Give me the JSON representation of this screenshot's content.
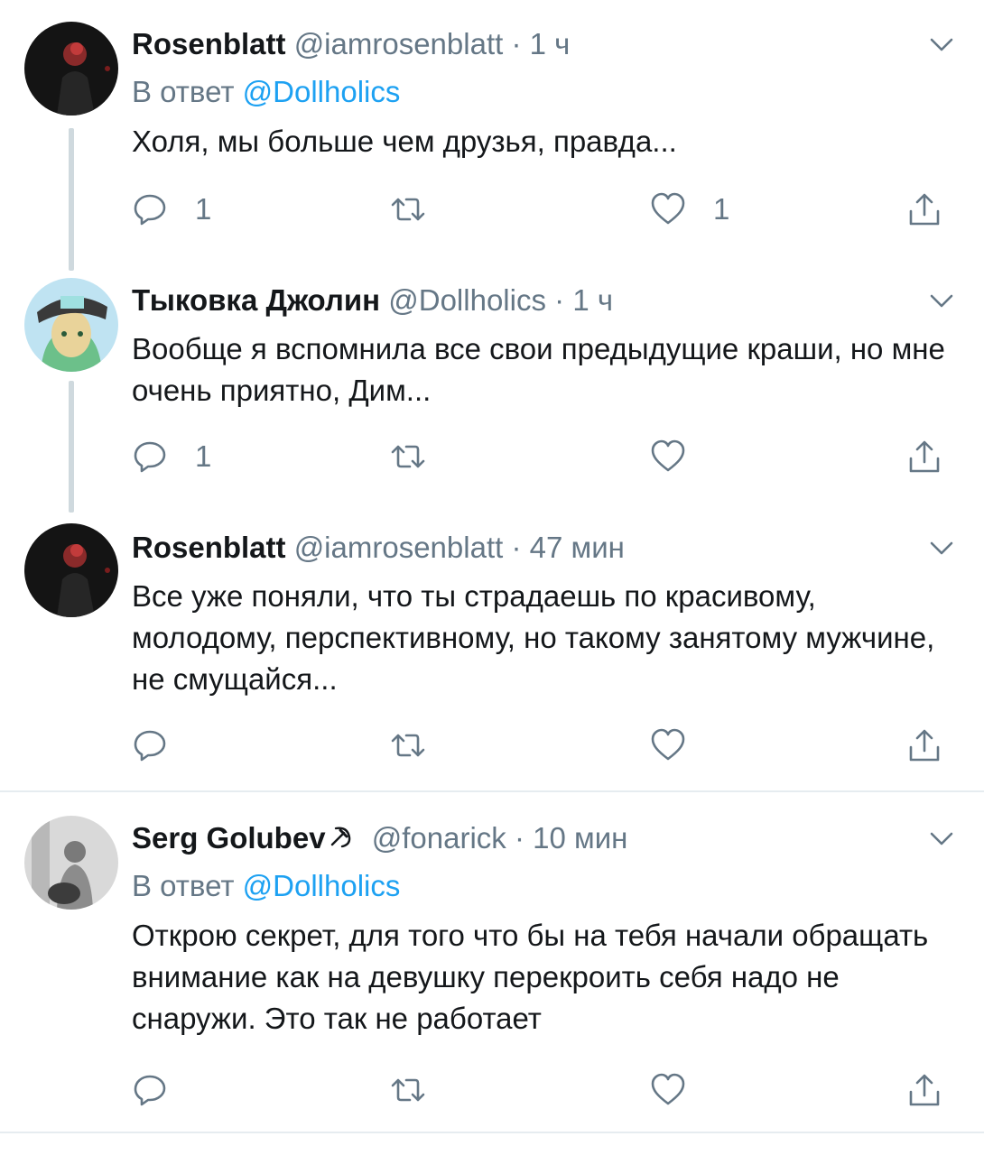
{
  "tweets": [
    {
      "name": "Rosenblatt",
      "handle": "@iamrosenblatt",
      "dot": "·",
      "time": "1 ч",
      "reply_prefix": "В ответ",
      "reply_link": "@Dollholics",
      "text": "Холя, мы больше чем друзья, правда...",
      "replies": "1",
      "retweets": "",
      "likes": "1"
    },
    {
      "name": "Тыковка Джолин",
      "handle": "@Dollholics",
      "dot": "·",
      "time": "1 ч",
      "text": "Вообще я вспомнила все свои предыдущие краши, но мне очень приятно,  Дим...",
      "replies": "1",
      "retweets": "",
      "likes": ""
    },
    {
      "name": "Rosenblatt",
      "handle": "@iamrosenblatt",
      "dot": "·",
      "time": "47 мин",
      "text": "Все уже поняли, что ты страдаешь по красивому, молодому, перспективному, но такому занятому мужчине, не смущайся...",
      "replies": "",
      "retweets": "",
      "likes": ""
    },
    {
      "name": "Serg Golubev",
      "badge": "☭",
      "handle": "@fonarick",
      "dot": "·",
      "time": "10 мин",
      "reply_prefix": "В ответ",
      "reply_link": "@Dollholics",
      "text": "Открою секрет, для того что бы на тебя начали обращать внимание как на девушку перекроить себя надо не снаружи. Это так не работает",
      "replies": "",
      "retweets": "",
      "likes": ""
    }
  ],
  "icons": {
    "reply": "reply-bubble-icon",
    "retweet": "retweet-icon",
    "like": "heart-icon",
    "share": "share-icon",
    "more": "chevron-down-icon"
  },
  "colors": {
    "text": "#14171a",
    "muted": "#657786",
    "link": "#1da1f2",
    "thread_line": "#cfd9de",
    "divider": "#e6ecf0"
  }
}
